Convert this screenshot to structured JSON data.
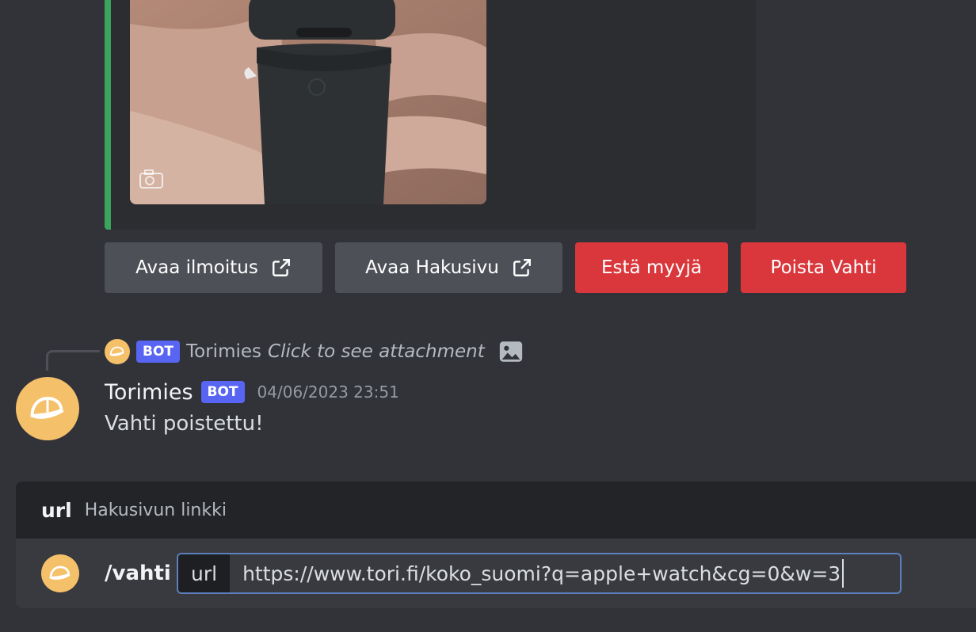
{
  "embed": {
    "accent_color": "#3ba55d",
    "image_icon": "camera-icon"
  },
  "buttons": {
    "open_listing": "Avaa ilmoitus",
    "open_search": "Avaa Hakusivu",
    "block_seller": "Estä myyjä",
    "delete_watch": "Poista Vahti"
  },
  "reply": {
    "bot_tag": "BOT",
    "author": "Torimies",
    "text": "Click to see attachment"
  },
  "message": {
    "author": "Torimies",
    "bot_tag": "BOT",
    "timestamp": "04/06/2023 23:51",
    "body": "Vahti poistettu!"
  },
  "command": {
    "option_name": "url",
    "option_description": "Hakusivun linkki",
    "command_name": "/vahti",
    "pill_label": "url",
    "pill_value": "https://www.tori.fi/koko_suomi?q=apple+watch&cg=0&w=3"
  },
  "colors": {
    "background": "#313338",
    "grey_button": "#4e5058",
    "red_button": "#da373c",
    "bot_tag": "#5865f2",
    "avatar": "#f5c06a"
  }
}
